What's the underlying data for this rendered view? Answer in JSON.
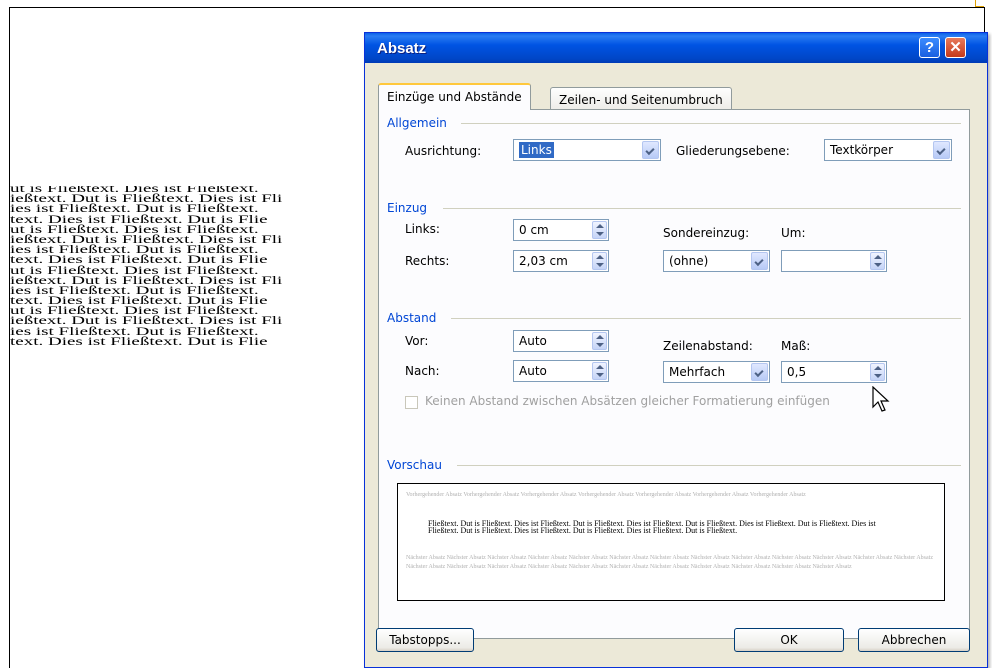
{
  "document": {
    "lines": [
      "ut is Fließtext. Dies ist Fließtext. ",
      "ießtext. Dut is Fließtext. Dies ist Fli",
      "ies ist Fließtext. Dut is Fließtext. ",
      "text. Dies ist Fließtext. Dut is Flie",
      "ut is Fließtext. Dies ist Fließtext. ",
      "ießtext. Dut is Fließtext. Dies ist Fli",
      "ies ist Fließtext. Dut is Fließtext. ",
      "text. Dies ist Fließtext. Dut is Flie",
      "ut is Fließtext. Dies ist Fließtext. ",
      "ießtext. Dut is Fließtext. Dies ist Fli",
      "ies ist Fließtext. Dut is Fließtext. ",
      "text. Dies ist Fließtext. Dut is Flie",
      "ut is Fließtext. Dies ist Fließtext. ",
      "ießtext. Dut is Fließtext. Dies ist Fli",
      "ies ist Fließtext. Dut is Fließtext. ",
      "text. Dies ist Fließtext. Dut is Flie"
    ]
  },
  "dialog": {
    "title": "Absatz",
    "help_icon": "?",
    "close_icon": "✕",
    "tabs": [
      {
        "label": "Einzüge und Abstände",
        "active": true
      },
      {
        "label": "Zeilen- und Seitenumbruch",
        "active": false
      }
    ],
    "allgemein": {
      "section_title": "Allgemein",
      "ausrichtung_label": "Ausrichtung:",
      "ausrichtung_value": "Links",
      "gliederung_label": "Gliederungsebene:",
      "gliederung_value": "Textkörper"
    },
    "einzug": {
      "section_title": "Einzug",
      "links_label": "Links:",
      "links_value": "0 cm",
      "rechts_label": "Rechts:",
      "rechts_value": "2,03 cm",
      "sondereinzug_label": "Sondereinzug:",
      "sondereinzug_value": "(ohne)",
      "um_label": "Um:",
      "um_value": ""
    },
    "abstand": {
      "section_title": "Abstand",
      "vor_label": "Vor:",
      "vor_value": "Auto",
      "nach_label": "Nach:",
      "nach_value": "Auto",
      "zeilenabstand_label": "Zeilenabstand:",
      "zeilenabstand_value": "Mehrfach",
      "mass_label": "Maß:",
      "mass_value": "0,5",
      "no_space_checkbox_label": "Keinen Abstand zwischen Absätzen gleicher Formatierung einfügen",
      "no_space_checked": false
    },
    "vorschau": {
      "section_title": "Vorschau",
      "prev_para": "Vorhergehender Absatz Vorhergehender Absatz Vorhergehender Absatz Vorhergehender Absatz Vorhergehender Absatz Vorhergehender Absatz Vorhergehender Absatz",
      "current_para": "Fließtext. Dut is Fließtext. Dies ist Fließtext. Dut is Fließtext. Dies ist Fließtext. Dut is Fließtext. Dies ist Fließtext. Dut is Fließtext. Dies ist Fließtext. Dut is Fließtext. Dies ist Fließtext. Dut is Fließtext. Dies ist Fließtext. Dut is Fließtext.",
      "next_para": "Nächster Absatz Nächster Absatz Nächster Absatz Nächster Absatz Nächster Absatz Nächster Absatz Nächster Absatz Nächster Absatz Nächster Absatz Nächster Absatz Nächster Absatz Nächster Absatz Nächster Absatz Nächster Absatz Nächster Absatz Nächster Absatz Nächster Absatz Nächster Absatz Nächster Absatz Nächster Absatz Nächster Absatz Nächster Absatz Nächster Absatz Nächster Absatz"
    },
    "buttons": {
      "tabstopps": "Tabstopps...",
      "ok": "OK",
      "cancel": "Abbrechen"
    }
  }
}
